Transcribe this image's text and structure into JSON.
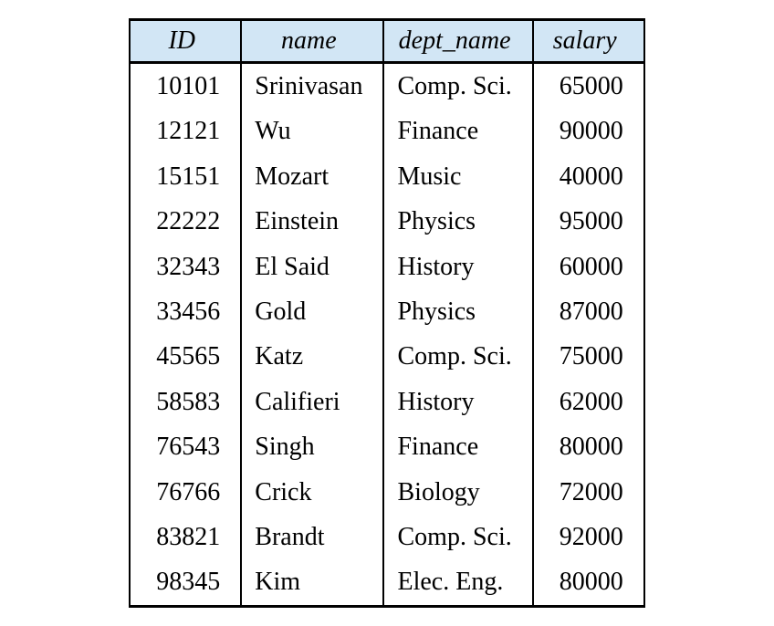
{
  "table": {
    "columns": [
      {
        "key": "id",
        "label": "ID"
      },
      {
        "key": "name",
        "label": "name"
      },
      {
        "key": "dept_name",
        "label": "dept_name"
      },
      {
        "key": "salary",
        "label": "salary"
      }
    ],
    "rows": [
      {
        "id": "10101",
        "name": "Srinivasan",
        "dept_name": "Comp. Sci.",
        "salary": "65000"
      },
      {
        "id": "12121",
        "name": "Wu",
        "dept_name": "Finance",
        "salary": "90000"
      },
      {
        "id": "15151",
        "name": "Mozart",
        "dept_name": "Music",
        "salary": "40000"
      },
      {
        "id": "22222",
        "name": "Einstein",
        "dept_name": "Physics",
        "salary": "95000"
      },
      {
        "id": "32343",
        "name": "El Said",
        "dept_name": "History",
        "salary": "60000"
      },
      {
        "id": "33456",
        "name": "Gold",
        "dept_name": "Physics",
        "salary": "87000"
      },
      {
        "id": "45565",
        "name": "Katz",
        "dept_name": "Comp. Sci.",
        "salary": "75000"
      },
      {
        "id": "58583",
        "name": "Califieri",
        "dept_name": "History",
        "salary": "62000"
      },
      {
        "id": "76543",
        "name": "Singh",
        "dept_name": "Finance",
        "salary": "80000"
      },
      {
        "id": "76766",
        "name": "Crick",
        "dept_name": "Biology",
        "salary": "72000"
      },
      {
        "id": "83821",
        "name": "Brandt",
        "dept_name": "Comp. Sci.",
        "salary": "92000"
      },
      {
        "id": "98345",
        "name": "Kim",
        "dept_name": "Elec. Eng.",
        "salary": "80000"
      }
    ]
  }
}
